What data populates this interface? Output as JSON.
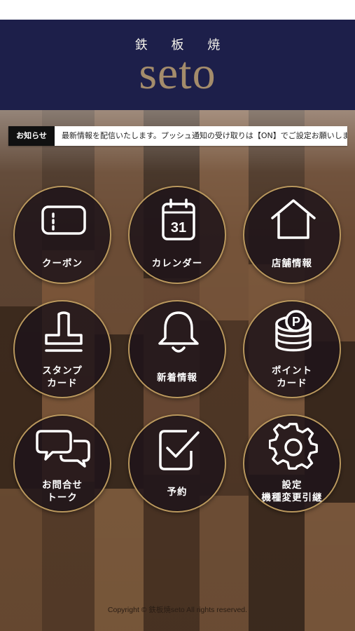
{
  "header": {
    "subtitle": "鉄 板 焼",
    "logo": "seto"
  },
  "news": {
    "label": "お知らせ",
    "text": "最新情報を配信いたします。プッシュ通知の受け取りは【ON】でご設定お願いします。"
  },
  "menu": [
    {
      "label": "クーポン",
      "label2": "",
      "icon": "coupon-icon"
    },
    {
      "label": "カレンダー",
      "label2": "",
      "icon": "calendar-icon",
      "icon_text": "31"
    },
    {
      "label": "店舗情報",
      "label2": "",
      "icon": "house-icon"
    },
    {
      "label": "スタンプ",
      "label2": "カード",
      "icon": "stamp-icon"
    },
    {
      "label": "新着情報",
      "label2": "",
      "icon": "bell-icon"
    },
    {
      "label": "ポイント",
      "label2": "カード",
      "icon": "coins-icon",
      "icon_text": "P"
    },
    {
      "label": "お問合せ",
      "label2": "トーク",
      "icon": "chat-bubbles-icon"
    },
    {
      "label": "予約",
      "label2": "",
      "icon": "clipboard-check-icon"
    },
    {
      "label": "設定",
      "label2": "機種変更引継",
      "icon": "gear-icon"
    }
  ],
  "footer": {
    "copyright": "Copyright © 鉄板焼seto All rights reserved."
  },
  "colors": {
    "header_bg": "#1d1f4a",
    "logo_gold": "#a48c6b",
    "tile_border": "#b9975d"
  }
}
